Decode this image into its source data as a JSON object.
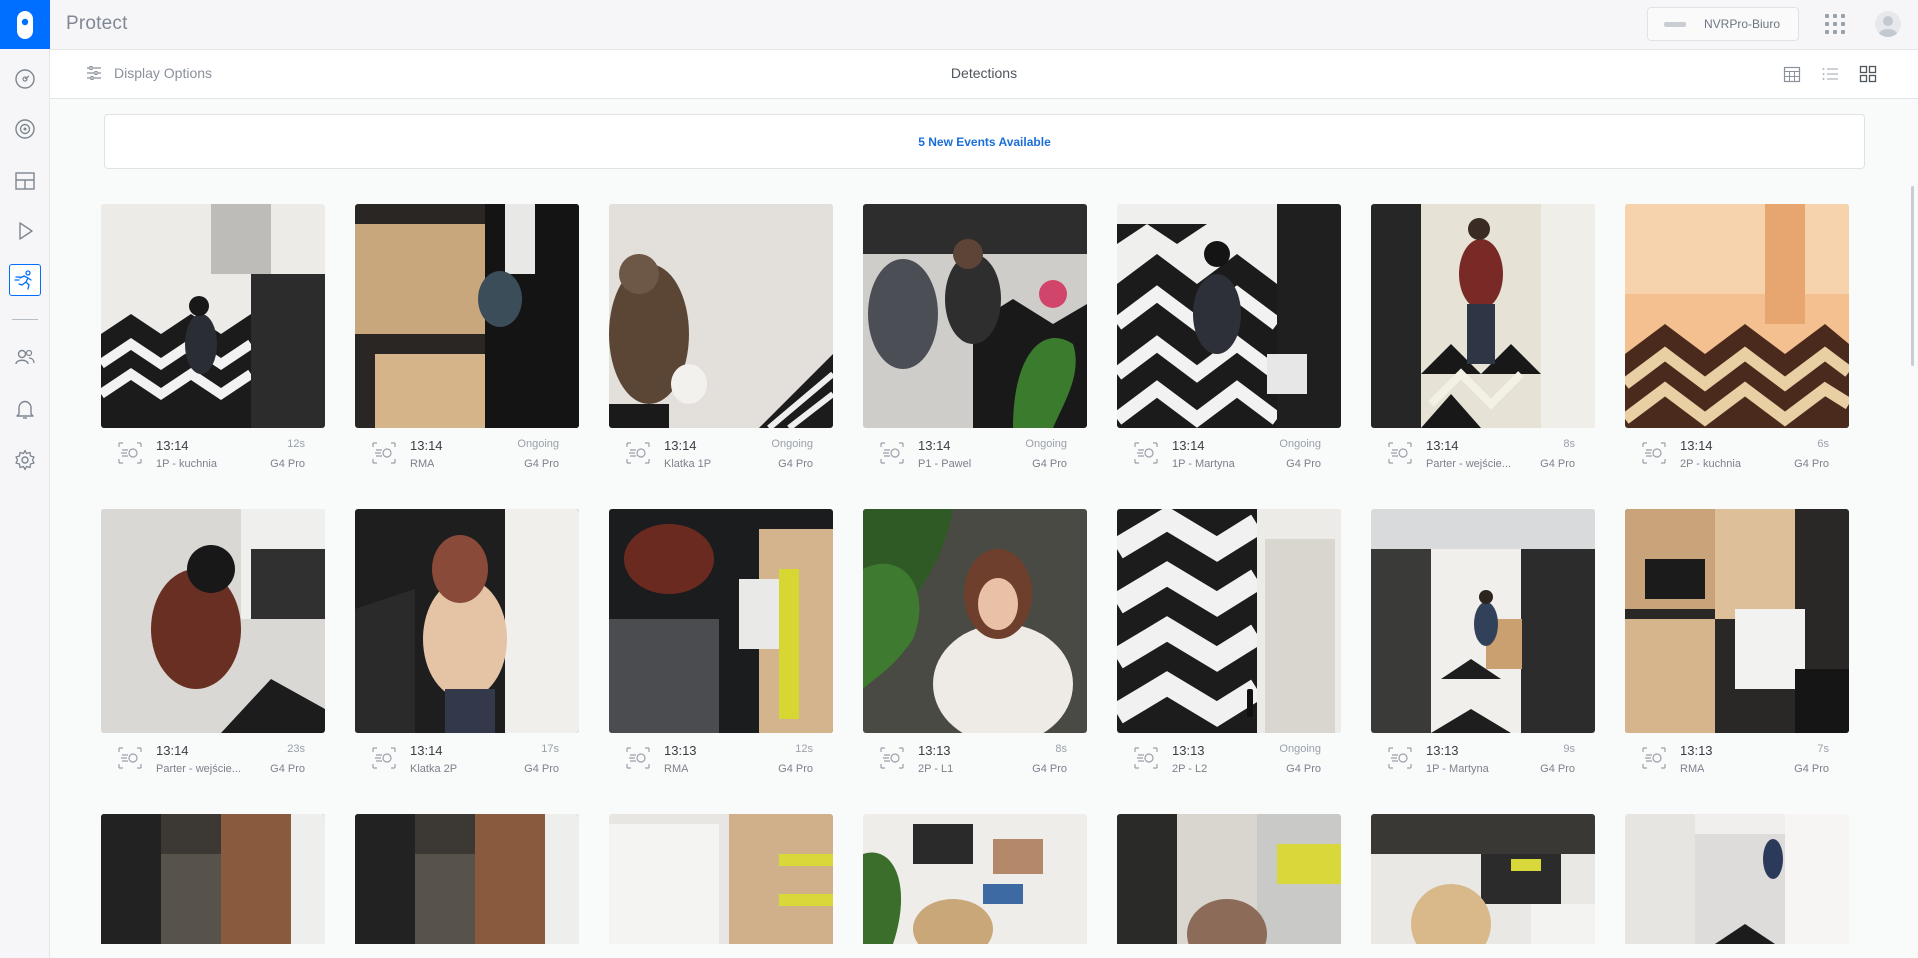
{
  "app": {
    "title": "Protect",
    "nvr_name": "NVRPro-Biuro"
  },
  "subheader": {
    "display_options": "Display Options",
    "title": "Detections"
  },
  "banner": {
    "text": "5 New Events Available"
  },
  "sidebar": {
    "items": [
      {
        "name": "dashboard",
        "icon": "dashboard-icon"
      },
      {
        "name": "devices",
        "icon": "camera-icon"
      },
      {
        "name": "liveview",
        "icon": "liveview-grid-icon"
      },
      {
        "name": "timelines",
        "icon": "play-icon"
      },
      {
        "name": "detections",
        "icon": "running-person-icon",
        "active": true
      },
      {
        "name": "users",
        "icon": "users-icon"
      },
      {
        "name": "alerts",
        "icon": "bell-icon"
      },
      {
        "name": "settings",
        "icon": "gear-icon"
      }
    ]
  },
  "events": [
    {
      "time": "13:14",
      "camera": "1P - kuchnia",
      "duration": "12s",
      "model": "G4 Pro"
    },
    {
      "time": "13:14",
      "camera": "RMA",
      "duration": "Ongoing",
      "model": "G4 Pro"
    },
    {
      "time": "13:14",
      "camera": "Klatka 1P",
      "duration": "Ongoing",
      "model": "G4 Pro"
    },
    {
      "time": "13:14",
      "camera": "P1 - Pawel",
      "duration": "Ongoing",
      "model": "G4 Pro"
    },
    {
      "time": "13:14",
      "camera": "1P - Martyna",
      "duration": "Ongoing",
      "model": "G4 Pro"
    },
    {
      "time": "13:14",
      "camera": "Parter - wejście...",
      "duration": "8s",
      "model": "G4 Pro"
    },
    {
      "time": "13:14",
      "camera": "2P - kuchnia",
      "duration": "6s",
      "model": "G4 Pro"
    },
    {
      "time": "13:14",
      "camera": "Parter - wejście...",
      "duration": "23s",
      "model": "G4 Pro"
    },
    {
      "time": "13:14",
      "camera": "Klatka 2P",
      "duration": "17s",
      "model": "G4 Pro"
    },
    {
      "time": "13:13",
      "camera": "RMA",
      "duration": "12s",
      "model": "G4 Pro"
    },
    {
      "time": "13:13",
      "camera": "2P - L1",
      "duration": "8s",
      "model": "G4 Pro"
    },
    {
      "time": "13:13",
      "camera": "2P - L2",
      "duration": "Ongoing",
      "model": "G4 Pro"
    },
    {
      "time": "13:13",
      "camera": "1P - Martyna",
      "duration": "9s",
      "model": "G4 Pro"
    },
    {
      "time": "13:13",
      "camera": "RMA",
      "duration": "7s",
      "model": "G4 Pro"
    }
  ],
  "colors": {
    "accent": "#006fff",
    "link": "#1a6ed8"
  }
}
